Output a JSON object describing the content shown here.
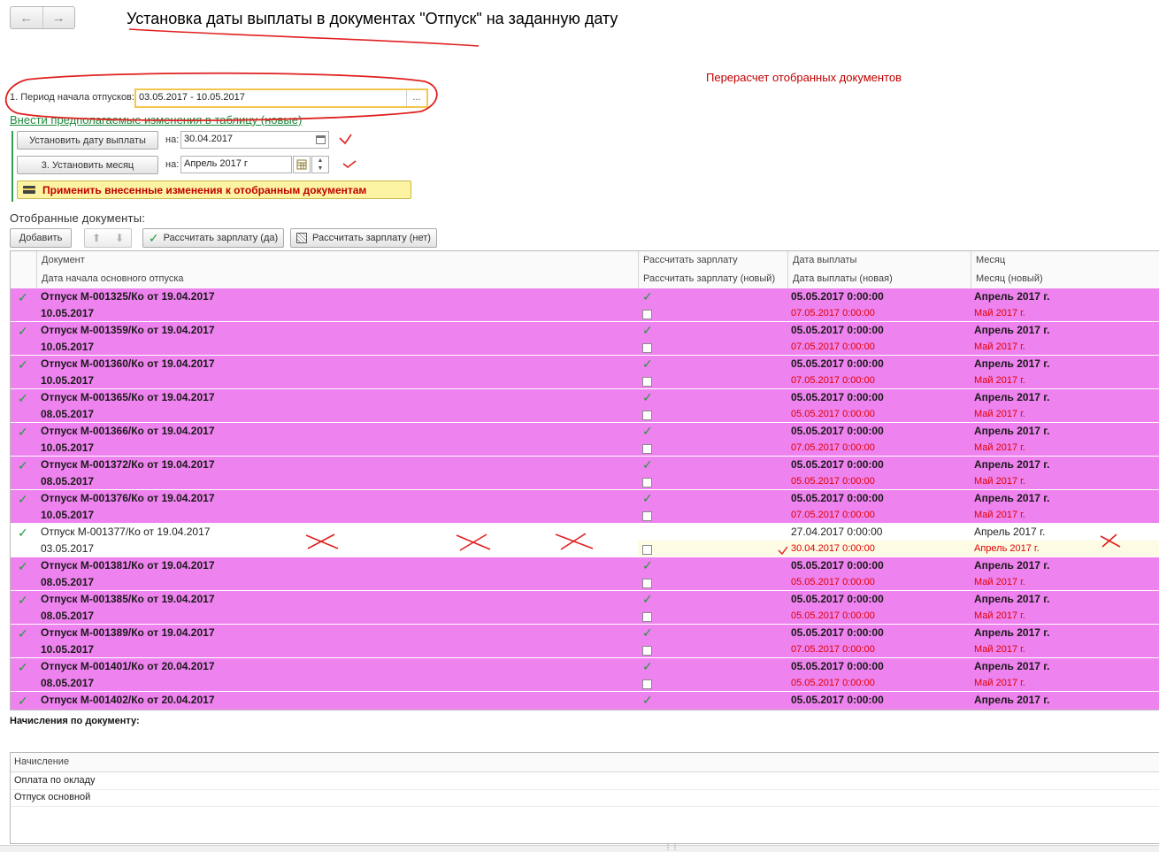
{
  "nav": {
    "back_icon": "arrow-left-icon",
    "forward_icon": "arrow-right-icon"
  },
  "title": "Установка даты выплаты в документах \"Отпуск\" на заданную дату",
  "recalc_link": "Перерасчет отобранных документов",
  "period": {
    "label": "1. Период начала отпусков:",
    "value": "03.05.2017 - 10.05.2017",
    "select_label": "..."
  },
  "changes_link": "Внести предполагаемые изменения в таблицу (новые)",
  "set_date": {
    "button": "Установить дату выплаты",
    "na_label": "на:",
    "value": "30.04.2017"
  },
  "set_month": {
    "button": "3. Установить месяц",
    "na_label": "на:",
    "value": "Апрель 2017 г"
  },
  "apply_button": "Применить внесенные изменения к отобранным документам",
  "selected_title": "Отобранные документы:",
  "toolbar": {
    "add": "Добавить",
    "calc_yes": "Рассчитать зарплату (да)",
    "calc_no": "Рассчитать зарплату (нет)"
  },
  "columns": {
    "doc": "Документ",
    "doc_sub": "Дата начала основного отпуска",
    "calc": "Рассчитать зарплату",
    "calc_sub": "Рассчитать зарплату (новый)",
    "pay": "Дата выплаты",
    "pay_sub": "Дата выплаты (новая)",
    "month": "Месяц",
    "month_sub": "Месяц (новый)"
  },
  "rows": [
    {
      "doc": "Отпуск М-001325/Ко от 19.04.2017",
      "start": "10.05.2017",
      "pay": "05.05.2017 0:00:00",
      "pay_new": "07.05.2017 0:00:00",
      "month": "Апрель 2017 г.",
      "month_new": "Май 2017 г."
    },
    {
      "doc": "Отпуск М-001359/Ко от 19.04.2017",
      "start": "10.05.2017",
      "pay": "05.05.2017 0:00:00",
      "pay_new": "07.05.2017 0:00:00",
      "month": "Апрель 2017 г.",
      "month_new": "Май 2017 г."
    },
    {
      "doc": "Отпуск М-001360/Ко от 19.04.2017",
      "start": "10.05.2017",
      "pay": "05.05.2017 0:00:00",
      "pay_new": "07.05.2017 0:00:00",
      "month": "Апрель 2017 г.",
      "month_new": "Май 2017 г."
    },
    {
      "doc": "Отпуск М-001365/Ко от 19.04.2017",
      "start": "08.05.2017",
      "pay": "05.05.2017 0:00:00",
      "pay_new": "05.05.2017 0:00:00",
      "month": "Апрель 2017 г.",
      "month_new": "Май 2017 г."
    },
    {
      "doc": "Отпуск М-001366/Ко от 19.04.2017",
      "start": "10.05.2017",
      "pay": "05.05.2017 0:00:00",
      "pay_new": "07.05.2017 0:00:00",
      "month": "Апрель 2017 г.",
      "month_new": "Май 2017 г."
    },
    {
      "doc": "Отпуск М-001372/Ко от 19.04.2017",
      "start": "08.05.2017",
      "pay": "05.05.2017 0:00:00",
      "pay_new": "05.05.2017 0:00:00",
      "month": "Апрель 2017 г.",
      "month_new": "Май 2017 г."
    },
    {
      "doc": "Отпуск М-001376/Ко от 19.04.2017",
      "start": "10.05.2017",
      "pay": "05.05.2017 0:00:00",
      "pay_new": "07.05.2017 0:00:00",
      "month": "Апрель 2017 г.",
      "month_new": "Май 2017 г."
    },
    {
      "doc": "Отпуск М-001377/Ко от 19.04.2017",
      "start": "03.05.2017",
      "pay": "27.04.2017 0:00:00",
      "pay_new": "30.04.2017 0:00:00",
      "month": "Апрель 2017 г.",
      "month_new": "Апрель 2017 г."
    },
    {
      "doc": "Отпуск М-001381/Ко от 19.04.2017",
      "start": "08.05.2017",
      "pay": "05.05.2017 0:00:00",
      "pay_new": "05.05.2017 0:00:00",
      "month": "Апрель 2017 г.",
      "month_new": "Май 2017 г."
    },
    {
      "doc": "Отпуск М-001385/Ко от 19.04.2017",
      "start": "08.05.2017",
      "pay": "05.05.2017 0:00:00",
      "pay_new": "05.05.2017 0:00:00",
      "month": "Апрель 2017 г.",
      "month_new": "Май 2017 г."
    },
    {
      "doc": "Отпуск М-001389/Ко от 19.04.2017",
      "start": "10.05.2017",
      "pay": "05.05.2017 0:00:00",
      "pay_new": "07.05.2017 0:00:00",
      "month": "Апрель 2017 г.",
      "month_new": "Май 2017 г."
    },
    {
      "doc": "Отпуск М-001401/Ко от 20.04.2017",
      "start": "08.05.2017",
      "pay": "05.05.2017 0:00:00",
      "pay_new": "05.05.2017 0:00:00",
      "month": "Апрель 2017 г.",
      "month_new": "Май 2017 г."
    },
    {
      "doc": "Отпуск М-001402/Ко от 20.04.2017",
      "start": "",
      "pay": "05.05.2017 0:00:00",
      "pay_new": "",
      "month": "Апрель 2017 г.",
      "month_new": ""
    }
  ],
  "accruals": {
    "title": "Начисления по документу:",
    "header": "Начисление",
    "items": [
      "Оплата по окладу",
      "Отпуск основной"
    ]
  },
  "colors": {
    "row_highlight": "#ee82ee",
    "red_text": "#e00000",
    "green": "#1e8a3d",
    "apply_bg": "#fdf4a3"
  }
}
